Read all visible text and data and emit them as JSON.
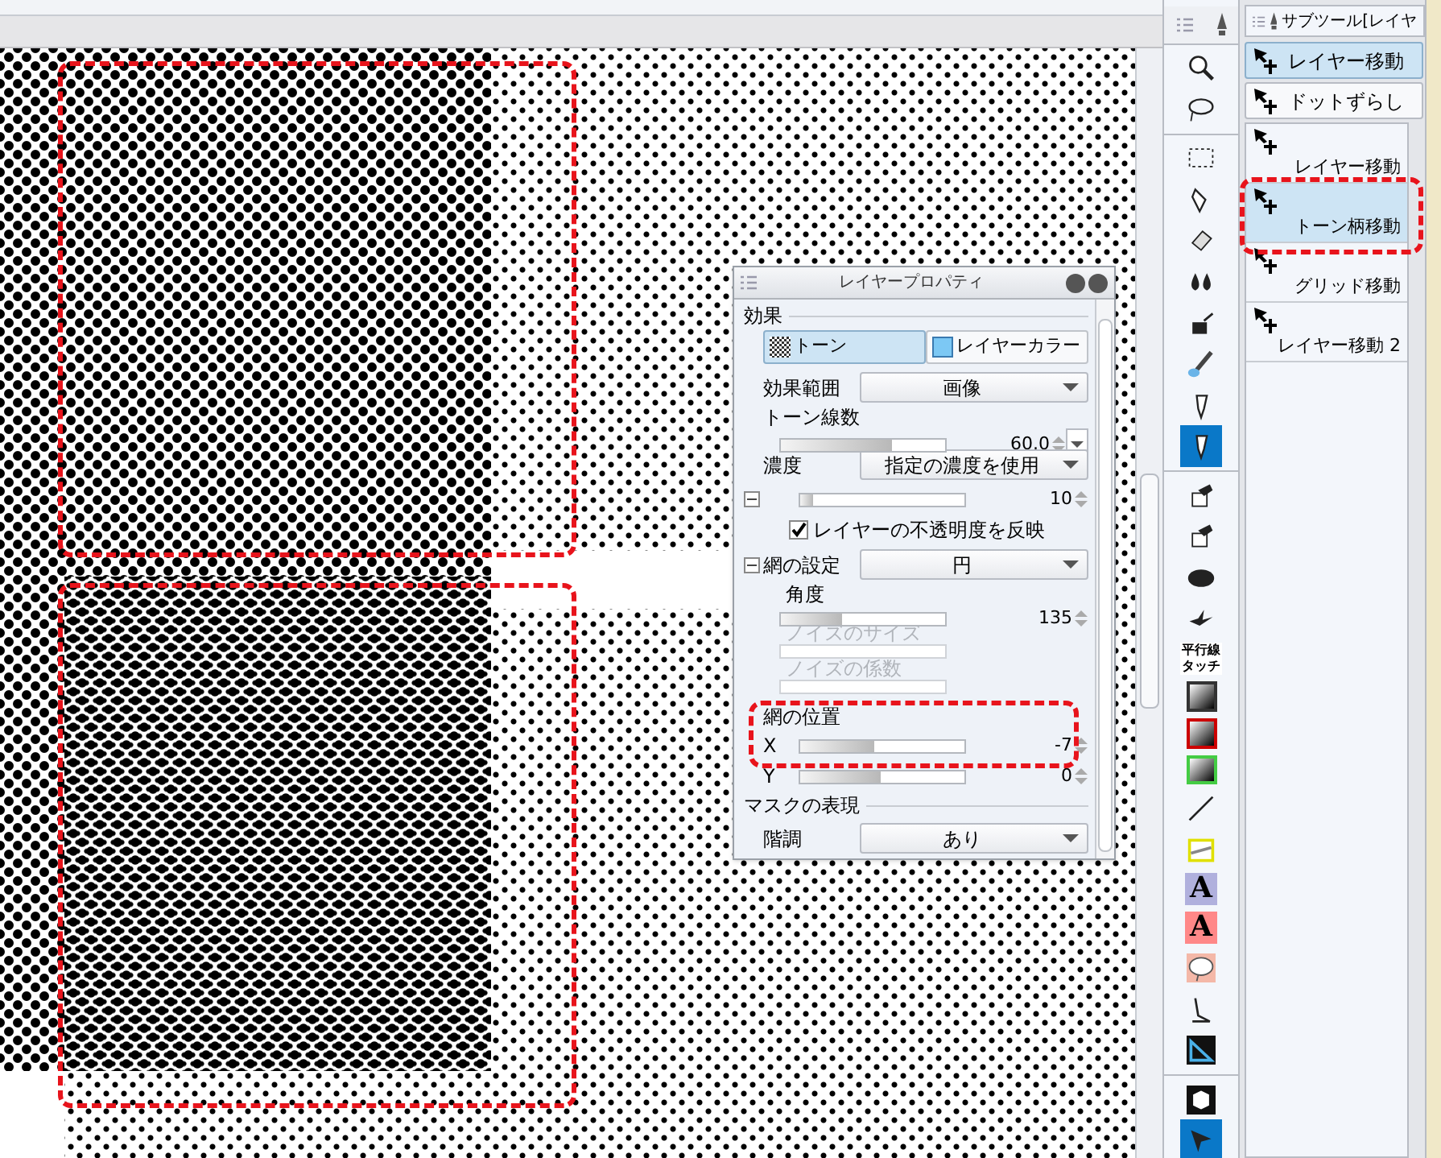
{
  "dialog": {
    "title": "レイヤープロパティ",
    "rows": [
      {
        "kind": "section",
        "label": "効果"
      },
      {
        "kind": "toggle",
        "buttons": [
          {
            "label": "トーン",
            "selected": true
          },
          {
            "label": "レイヤーカラー",
            "selected": false
          }
        ]
      },
      {
        "kind": "dropdown",
        "label": "効果範囲",
        "value": "画像"
      },
      {
        "kind": "slider",
        "label": "トーン線数",
        "value": "60.0",
        "level": 0.68,
        "disabled": false
      },
      {
        "kind": "dropdown",
        "label": "濃度",
        "value": "指定の濃度を使用"
      },
      {
        "kind": "inline_slider",
        "label": "",
        "value": "10",
        "level": 0.08,
        "expanded": true
      },
      {
        "kind": "checkbox",
        "label": "レイヤーの不透明度を反映",
        "checked": true
      },
      {
        "kind": "dropdown",
        "label": "網の設定",
        "value": "円",
        "expanded": true
      },
      {
        "kind": "slider",
        "label": "角度",
        "value": "135",
        "level": 0.37,
        "disabled": false
      },
      {
        "kind": "slider",
        "label": "ノイズのサイズ",
        "value": "",
        "disabled": true
      },
      {
        "kind": "slider",
        "label": "ノイズの係数",
        "value": "",
        "disabled": true
      },
      {
        "kind": "heading",
        "label": "網の位置"
      },
      {
        "kind": "inline_slider",
        "label": "X",
        "value": "-7",
        "level": 0.45
      },
      {
        "kind": "inline_slider",
        "label": "Y",
        "value": "0",
        "level": 0.49
      },
      {
        "kind": "section",
        "label": "マスクの表現"
      },
      {
        "kind": "dropdown",
        "label": "階調",
        "value": "あり"
      }
    ]
  },
  "tools": [
    {
      "kind": "zoom",
      "selected": false
    },
    {
      "kind": "lasso",
      "selected": false
    },
    {
      "kind": "rect",
      "selected": false
    },
    {
      "kind": "pen",
      "selected": false
    },
    {
      "kind": "eraser",
      "selected": false
    },
    {
      "kind": "drops",
      "selected": false
    },
    {
      "kind": "bottle",
      "selected": false
    },
    {
      "kind": "brush",
      "selected": false
    },
    {
      "kind": "nib",
      "selected": false
    },
    {
      "kind": "nib",
      "selected": true
    },
    {
      "kind": "bucket",
      "selected": false
    },
    {
      "kind": "bucket",
      "selected": false
    },
    {
      "kind": "blob",
      "selected": false
    },
    {
      "kind": "bird",
      "selected": false
    },
    {
      "kind": "text",
      "label": "平行線タッチ",
      "selected": false
    },
    {
      "kind": "gradient",
      "color": "#333333",
      "selected": false
    },
    {
      "kind": "gradient",
      "color": "#cc0000",
      "selected": false
    },
    {
      "kind": "gradient",
      "color": "#44cc44",
      "selected": false
    },
    {
      "kind": "line",
      "selected": false
    },
    {
      "kind": "frame",
      "selected": false
    },
    {
      "kind": "letter",
      "label": "A",
      "color": "#b0b0dd",
      "selected": false
    },
    {
      "kind": "letter",
      "label": "A",
      "color": "#ff8888",
      "selected": false
    },
    {
      "kind": "balloon",
      "selected": false
    },
    {
      "kind": "ruler",
      "selected": false
    },
    {
      "kind": "triangle",
      "selected": false
    },
    {
      "kind": "cube",
      "selected": false
    },
    {
      "kind": "cursor",
      "selected": true
    }
  ],
  "subtool": {
    "tab": "サブツール[レイヤ",
    "groups": [
      {
        "label": "レイヤー移動",
        "selected": true
      },
      {
        "label": "ドットずらし",
        "selected": false
      }
    ],
    "items": [
      {
        "label": "レイヤー移動",
        "selected": false
      },
      {
        "label": "トーン柄移動",
        "selected": true
      },
      {
        "label": "グリッド移動",
        "selected": false
      },
      {
        "label": "レイヤー移動 2",
        "selected": false
      }
    ]
  }
}
